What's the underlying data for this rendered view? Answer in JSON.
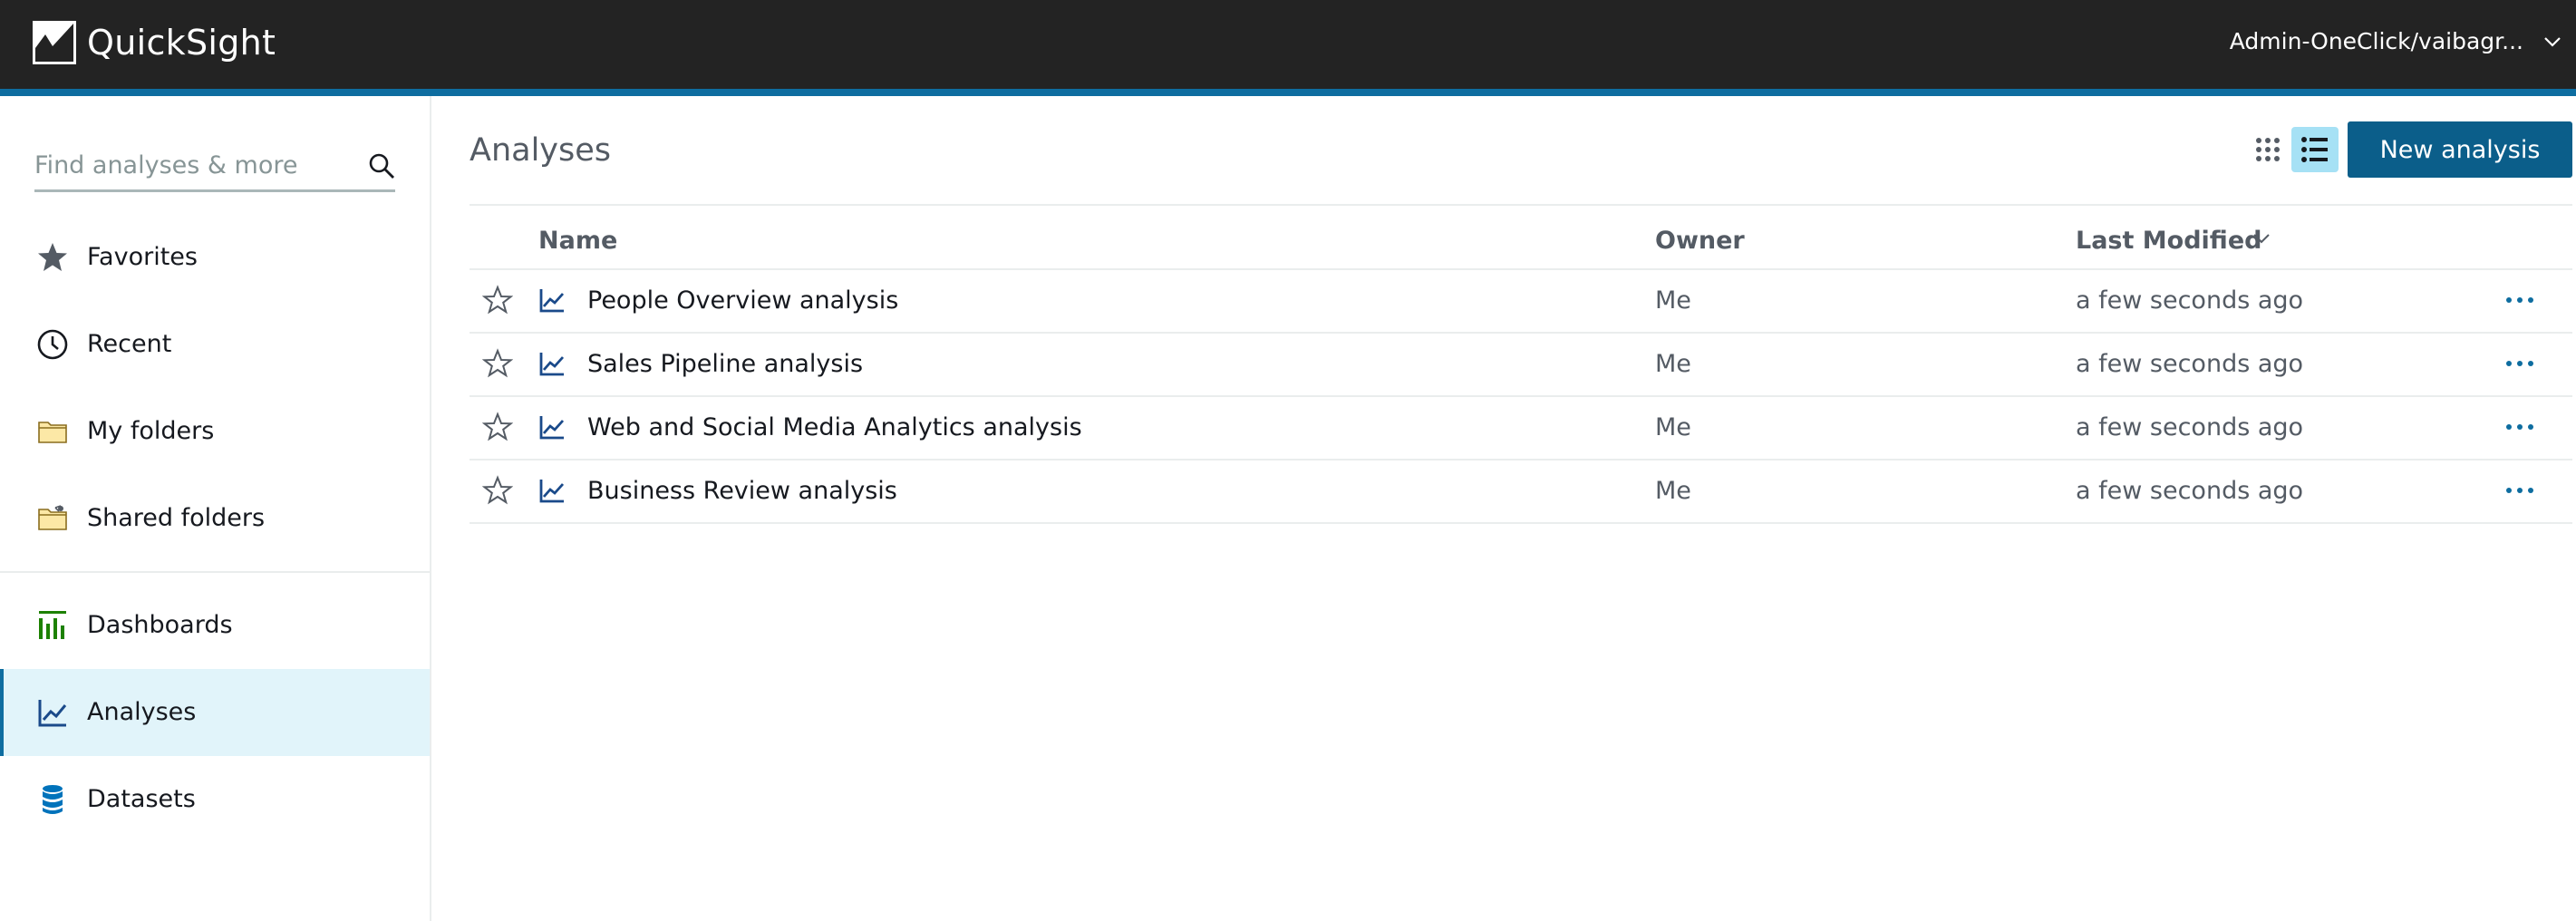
{
  "app": {
    "name": "QuickSight",
    "user": "Admin-OneClick/vaibagr..."
  },
  "colors": {
    "topbar": "#232323",
    "accent": "#0e6da0",
    "primary_button": "#0b5e8a",
    "active_nav_bg": "#e1f4fa",
    "dashboards_icon": "#1d8102",
    "datasets_icon": "#0073bb",
    "analysis_icon": "#1a4a8a"
  },
  "sidebar": {
    "search": {
      "placeholder": "Find analyses & more",
      "value": ""
    },
    "items": [
      {
        "label": "Favorites",
        "icon": "star-icon"
      },
      {
        "label": "Recent",
        "icon": "clock-icon"
      },
      {
        "label": "My folders",
        "icon": "folder-icon"
      },
      {
        "label": "Shared folders",
        "icon": "shared-folder-icon"
      },
      {
        "label": "Dashboards",
        "icon": "bar-chart-icon"
      },
      {
        "label": "Analyses",
        "icon": "line-chart-icon",
        "active": true
      },
      {
        "label": "Datasets",
        "icon": "database-icon"
      }
    ]
  },
  "main": {
    "title": "Analyses",
    "new_button": "New analysis",
    "view_modes": [
      "grid-view-icon",
      "list-view-icon"
    ],
    "active_view": "list",
    "table": {
      "columns": {
        "name": "Name",
        "owner": "Owner",
        "modified": "Last Modified"
      },
      "sort_column": "Last Modified",
      "rows": [
        {
          "name": "People Overview analysis",
          "owner": "Me",
          "modified": "a few seconds ago"
        },
        {
          "name": "Sales Pipeline analysis",
          "owner": "Me",
          "modified": "a few seconds ago"
        },
        {
          "name": "Web and Social Media Analytics analysis",
          "owner": "Me",
          "modified": "a few seconds ago"
        },
        {
          "name": "Business Review analysis",
          "owner": "Me",
          "modified": "a few seconds ago"
        }
      ]
    }
  }
}
